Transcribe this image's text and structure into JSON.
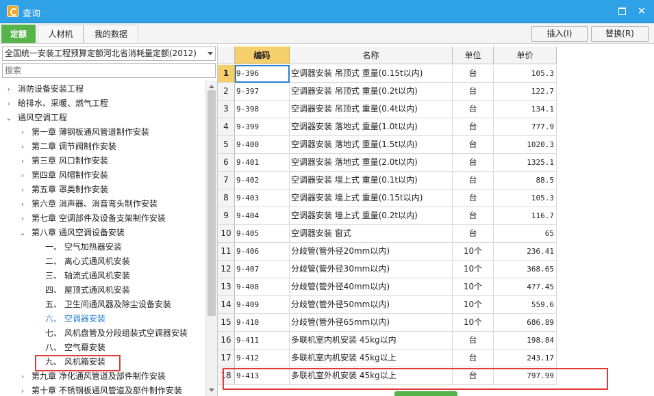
{
  "window": {
    "title": "查询",
    "close_glyph": "✕"
  },
  "tabs": [
    {
      "label": "定额",
      "active": true
    },
    {
      "label": "人材机",
      "active": false
    },
    {
      "label": "我的数据",
      "active": false
    }
  ],
  "toolbar": {
    "insert_label": "插入(I)",
    "replace_label": "替换(R)"
  },
  "left_panel": {
    "quota_library": "全国统一安装工程预算定额河北省消耗量定额(2012)",
    "search_placeholder": "搜索",
    "tree": [
      {
        "label": "消防设备安装工程",
        "level": 0,
        "expander": "›"
      },
      {
        "label": "给排水、采暖、燃气工程",
        "level": 0,
        "expander": "›"
      },
      {
        "label": "通风空调工程",
        "level": 0,
        "expander": "⌄"
      },
      {
        "label": "第一章 薄钢板通风管道制作安装",
        "level": 1,
        "expander": "›"
      },
      {
        "label": "第二章 调节阀制作安装",
        "level": 1,
        "expander": "›"
      },
      {
        "label": "第三章 风口制作安装",
        "level": 1,
        "expander": "›"
      },
      {
        "label": "第四章 风帽制作安装",
        "level": 1,
        "expander": "›"
      },
      {
        "label": "第五章 罩类制作安装",
        "level": 1,
        "expander": "›"
      },
      {
        "label": "第六章 消声器、消音弯头制作安装",
        "level": 1,
        "expander": "›"
      },
      {
        "label": "第七章 空调部件及设备支架制作安装",
        "level": 1,
        "expander": "›"
      },
      {
        "label": "第八章 通风空调设备安装",
        "level": 1,
        "expander": "⌄"
      },
      {
        "label": "一、 空气加热器安装",
        "level": 2,
        "expander": ""
      },
      {
        "label": "二、 离心式通风机安装",
        "level": 2,
        "expander": ""
      },
      {
        "label": "三、 轴流式通风机安装",
        "level": 2,
        "expander": ""
      },
      {
        "label": "四、 屋顶式通风机安装",
        "level": 2,
        "expander": ""
      },
      {
        "label": "五、 卫生间通风器及除尘设备安装",
        "level": 2,
        "expander": ""
      },
      {
        "label": "六、 空调器安装",
        "level": 2,
        "expander": "",
        "selected": true
      },
      {
        "label": "七、 风机盘管及分段组装式空调器安装",
        "level": 2,
        "expander": ""
      },
      {
        "label": "八、 空气幕安装",
        "level": 2,
        "expander": ""
      },
      {
        "label": "九、 风机箱安装",
        "level": 2,
        "expander": ""
      },
      {
        "label": "第九章 净化通风管道及部件制作安装",
        "level": 1,
        "expander": "›"
      },
      {
        "label": "第十章 不锈钢板通风管道及部件制作安装",
        "level": 1,
        "expander": "›"
      }
    ]
  },
  "grid": {
    "headers": {
      "code": "编码",
      "name": "名称",
      "unit": "单位",
      "price": "单价"
    },
    "rows": [
      {
        "no": "1",
        "code": "9-396",
        "name": "空调器安装 吊顶式 重量(0.15t以内)",
        "unit": "台",
        "price": "105.3"
      },
      {
        "no": "2",
        "code": "9-397",
        "name": "空调器安装 吊顶式 重量(0.2t以内)",
        "unit": "台",
        "price": "122.7"
      },
      {
        "no": "3",
        "code": "9-398",
        "name": "空调器安装 吊顶式 重量(0.4t以内)",
        "unit": "台",
        "price": "134.1"
      },
      {
        "no": "4",
        "code": "9-399",
        "name": "空调器安装 落地式 重量(1.0t以内)",
        "unit": "台",
        "price": "777.9"
      },
      {
        "no": "5",
        "code": "9-400",
        "name": "空调器安装 落地式 重量(1.5t以内)",
        "unit": "台",
        "price": "1020.3"
      },
      {
        "no": "6",
        "code": "9-401",
        "name": "空调器安装 落地式 重量(2.0t以内)",
        "unit": "台",
        "price": "1325.1"
      },
      {
        "no": "7",
        "code": "9-402",
        "name": "空调器安装 墙上式 重量(0.1t以内)",
        "unit": "台",
        "price": "88.5"
      },
      {
        "no": "8",
        "code": "9-403",
        "name": "空调器安装 墙上式 重量(0.15t以内)",
        "unit": "台",
        "price": "105.3"
      },
      {
        "no": "9",
        "code": "9-404",
        "name": "空调器安装 墙上式 重量(0.2t以内)",
        "unit": "台",
        "price": "116.7"
      },
      {
        "no": "10",
        "code": "9-405",
        "name": "空调器安装 窗式",
        "unit": "台",
        "price": "65"
      },
      {
        "no": "11",
        "code": "9-406",
        "name": "分歧管(管外径20mm以内)",
        "unit": "10个",
        "price": "236.41"
      },
      {
        "no": "12",
        "code": "9-407",
        "name": "分歧管(管外径30mm以内)",
        "unit": "10个",
        "price": "368.65"
      },
      {
        "no": "13",
        "code": "9-408",
        "name": "分歧管(管外径40mm以内)",
        "unit": "10个",
        "price": "477.45"
      },
      {
        "no": "14",
        "code": "9-409",
        "name": "分歧管(管外径50mm以内)",
        "unit": "10个",
        "price": "559.6"
      },
      {
        "no": "15",
        "code": "9-410",
        "name": "分歧管(管外径65mm以内)",
        "unit": "10个",
        "price": "686.89"
      },
      {
        "no": "16",
        "code": "9-411",
        "name": "多联机室内机安装 45kg以内",
        "unit": "台",
        "price": "198.84"
      },
      {
        "no": "17",
        "code": "9-412",
        "name": "多联机室内机安装 45kg以上",
        "unit": "台",
        "price": "243.17"
      },
      {
        "no": "18",
        "code": "9-413",
        "name": "多联机室外机安装 45kg以上",
        "unit": "台",
        "price": "797.99"
      }
    ]
  },
  "colors": {
    "titlebar": "#2fa1e6",
    "active_tab": "#56b44a",
    "header_highlight": "#f4cf6c",
    "annotation_red": "#e23a3a",
    "selected_text": "#2a7fd0"
  }
}
